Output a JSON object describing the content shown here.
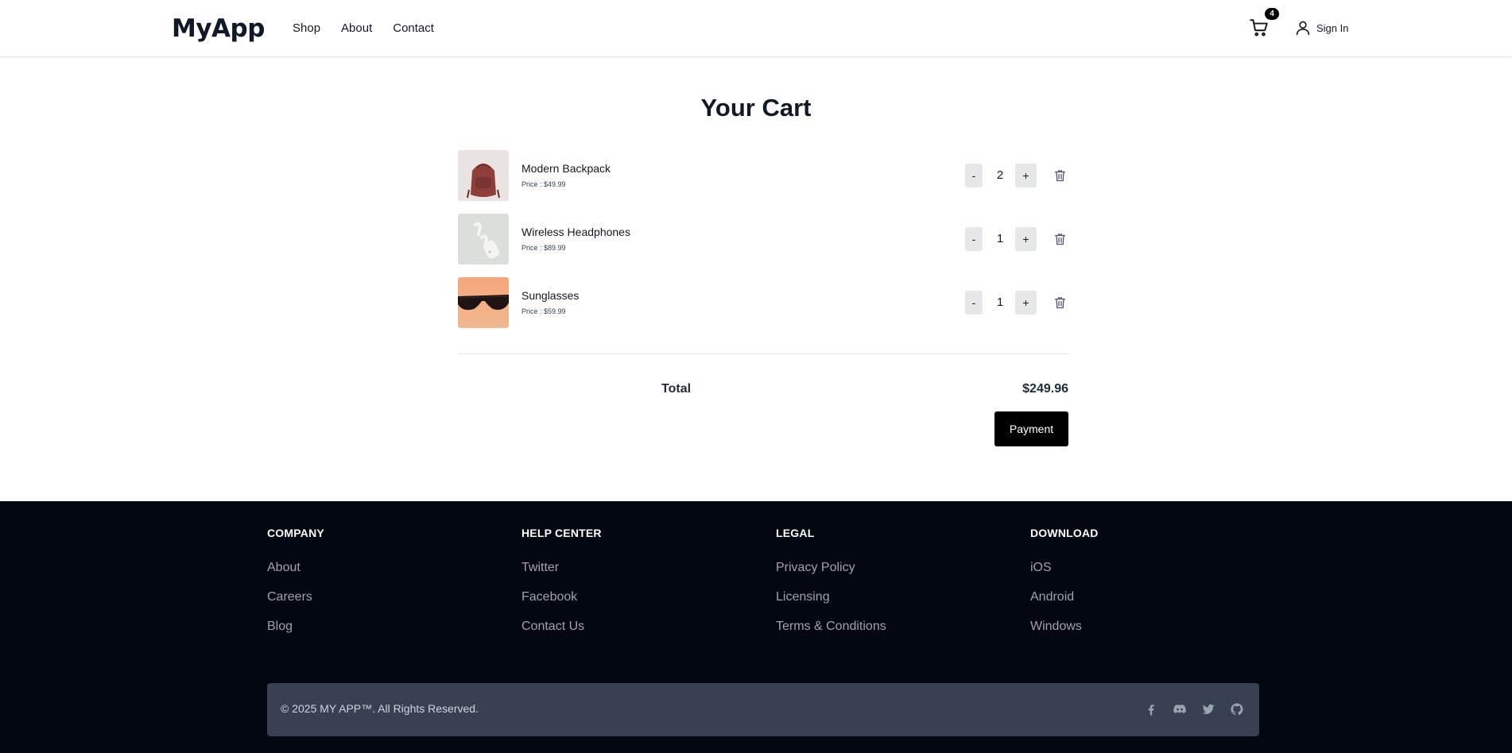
{
  "header": {
    "logo": "MyApp",
    "nav": [
      "Shop",
      "About",
      "Contact"
    ],
    "cart_count": "4",
    "signin": "Sign In"
  },
  "cart": {
    "title": "Your Cart",
    "items": [
      {
        "name": "Modern Backpack",
        "price": "Price : $49.99",
        "qty": "2",
        "minus": "-",
        "plus": "+"
      },
      {
        "name": "Wireless Headphones",
        "price": "Price : $89.99",
        "qty": "1",
        "minus": "-",
        "plus": "+"
      },
      {
        "name": "Sunglasses",
        "price": "Price : $59.99",
        "qty": "1",
        "minus": "-",
        "plus": "+"
      }
    ],
    "total_label": "Total",
    "total_value": "$249.96",
    "payment_label": "Payment"
  },
  "footer": {
    "columns": [
      {
        "title": "COMPANY",
        "links": [
          "About",
          "Careers",
          "Blog"
        ]
      },
      {
        "title": "HELP CENTER",
        "links": [
          "Twitter",
          "Facebook",
          "Contact Us"
        ]
      },
      {
        "title": "LEGAL",
        "links": [
          "Privacy Policy",
          "Licensing",
          "Terms & Conditions"
        ]
      },
      {
        "title": "DOWNLOAD",
        "links": [
          "iOS",
          "Android",
          "Windows"
        ]
      }
    ],
    "copyright": "© 2025 MY APP™. All Rights Reserved.",
    "social_icons": [
      "facebook-icon",
      "discord-icon",
      "twitter-icon",
      "github-icon"
    ]
  },
  "colors": {
    "footer_bg": "#030712",
    "footer_bar_bg": "#374151",
    "button_dark": "#000000",
    "qty_button_bg": "#e5e7eb"
  }
}
